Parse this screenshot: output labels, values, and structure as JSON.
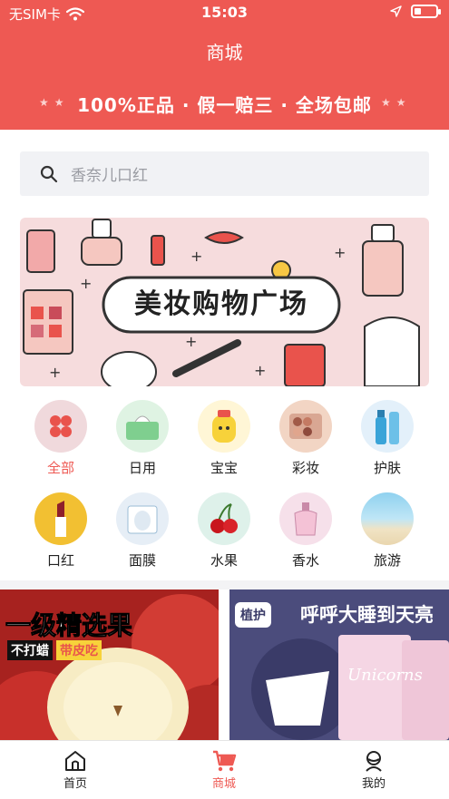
{
  "status_bar": {
    "carrier": "无SIM卡",
    "time": "15:03"
  },
  "header": {
    "title": "商城",
    "slogan": "100%正品 · 假一赔三 · 全场包邮"
  },
  "search": {
    "placeholder": "香奈儿口红"
  },
  "banner": {
    "text": "美妆购物广场"
  },
  "categories": [
    {
      "label": "全部",
      "icon": "grid-icon",
      "active": true
    },
    {
      "label": "日用",
      "icon": "tissue-icon"
    },
    {
      "label": "宝宝",
      "icon": "baby-bottle-icon"
    },
    {
      "label": "彩妆",
      "icon": "eyeshadow-palette-icon"
    },
    {
      "label": "护肤",
      "icon": "skincare-bottle-icon"
    },
    {
      "label": "口红",
      "icon": "lipstick-icon"
    },
    {
      "label": "面膜",
      "icon": "face-mask-icon"
    },
    {
      "label": "水果",
      "icon": "cherry-icon"
    },
    {
      "label": "香水",
      "icon": "perfume-icon"
    },
    {
      "label": "旅游",
      "icon": "beach-icon"
    }
  ],
  "products": [
    {
      "headline": "一级精选果",
      "tag1": "不打蜡",
      "tag2": "带皮吃"
    },
    {
      "brand": "植护",
      "headline": "呼呼大睡到天亮",
      "product_text": "Unicorns"
    }
  ],
  "tabbar": [
    {
      "label": "首页",
      "icon": "home-icon"
    },
    {
      "label": "商城",
      "icon": "cart-icon",
      "active": true
    },
    {
      "label": "我的",
      "icon": "user-icon"
    }
  ],
  "colors": {
    "accent": "#ee5953",
    "search_bg": "#f1f2f5",
    "banner_bg": "#f6dcdd"
  }
}
